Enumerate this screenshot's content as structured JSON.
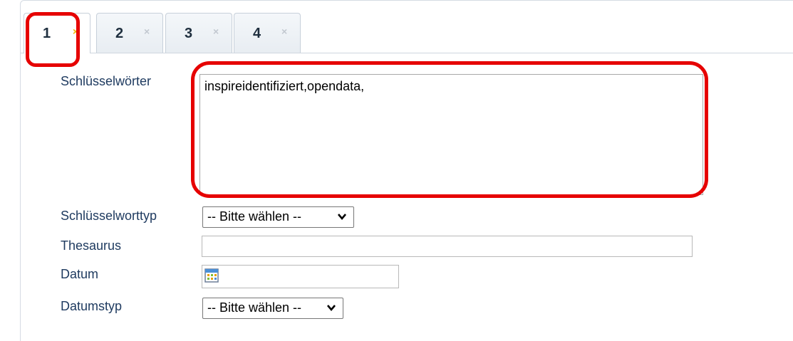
{
  "tabs": [
    {
      "label": "1",
      "close_icon": "×",
      "active": true
    },
    {
      "label": "2",
      "close_icon": "×",
      "active": false
    },
    {
      "label": "3",
      "close_icon": "×",
      "active": false
    },
    {
      "label": "4",
      "close_icon": "×",
      "active": false
    }
  ],
  "form": {
    "keywords_label": "Schlüsselwörter",
    "keywords_value": "inspireidentifiziert,opendata,",
    "keyword_type_label": "Schlüsselworttyp",
    "keyword_type_value": "-- Bitte wählen --",
    "thesaurus_label": "Thesaurus",
    "thesaurus_value": "",
    "date_label": "Datum",
    "date_value": "",
    "date_type_label": "Datumstyp",
    "date_type_value": "-- Bitte wählen --"
  },
  "icons": {
    "calendar": "calendar-icon",
    "chevron": "chevron-down-icon",
    "close": "close-icon"
  },
  "colors": {
    "highlight": "#e60000",
    "label": "#1f3b60",
    "active_tab_close": "#f0b400"
  }
}
